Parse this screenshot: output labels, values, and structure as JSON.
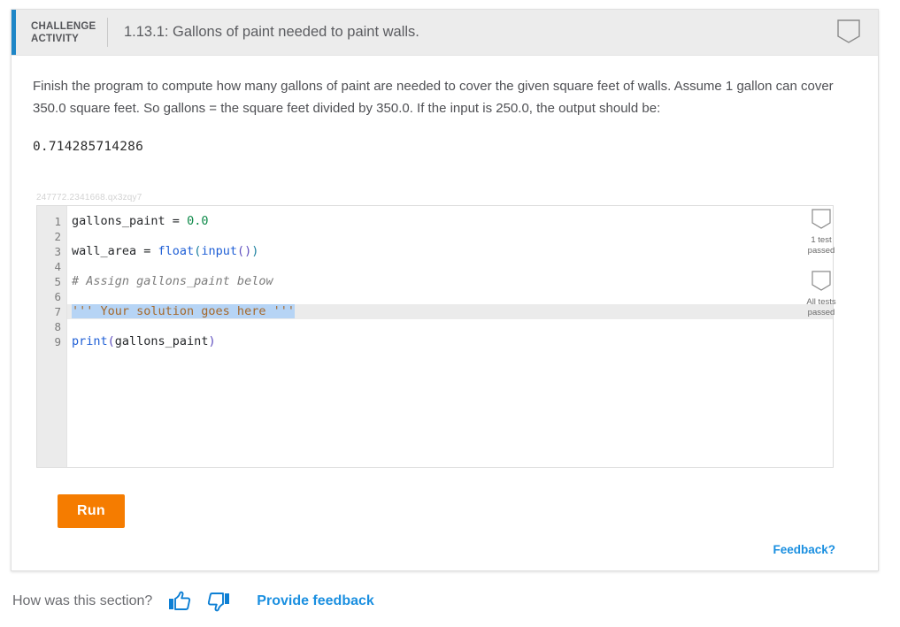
{
  "header": {
    "kicker_line1": "CHALLENGE",
    "kicker_line2": "ACTIVITY",
    "title": "1.13.1: Gallons of paint needed to paint walls.",
    "badge_icon": "shield-badge-icon",
    "accent_color": "#1e86c7"
  },
  "body": {
    "prompt": "Finish the program to compute how many gallons of paint are needed to cover the given square feet of walls. Assume 1 gallon can cover 350.0 square feet. So gallons = the square feet divided by 350.0. If the input is 250.0, the output should be:",
    "expected_output": "0.714285714286"
  },
  "editor": {
    "watermark": "247772.2341668.qx3zqy7",
    "line_numbers": [
      "1",
      "2",
      "3",
      "4",
      "5",
      "6",
      "7",
      "8",
      "9"
    ],
    "lines": [
      "gallons_paint = 0.0",
      "",
      "wall_area = float(input())",
      "",
      "# Assign gallons_paint below",
      "",
      "''' Your solution goes here '''",
      "",
      "print(gallons_paint)"
    ],
    "active_line": 7,
    "selected_text": "''' Your solution goes here '''",
    "l1_name": "gallons_paint ",
    "l1_eq": "= ",
    "l1_num": "0.0",
    "l3_name": "wall_area ",
    "l3_eq": "= ",
    "l3_float": "float",
    "l3_open": "(",
    "l3_input": "input",
    "l3_inner": "()",
    "l3_close": ")",
    "l5_comment": "# Assign gallons_paint below",
    "l7_text": "''' Your solution goes here '''",
    "l9_print": "print",
    "l9_open": "(",
    "l9_arg": "gallons_paint",
    "l9_close": ")"
  },
  "tests": [
    {
      "icon": "shield-outline-icon",
      "label_line1": "1 test",
      "label_line2": "passed"
    },
    {
      "icon": "shield-outline-icon",
      "label_line1": "All tests",
      "label_line2": "passed"
    }
  ],
  "actions": {
    "run_label": "Run",
    "run_color": "#f57c00",
    "feedback_label": "Feedback?",
    "link_color": "#1a8fe0"
  },
  "section_feedback": {
    "question": "How was this section?",
    "thumbs_up_icon": "thumbs-up-icon",
    "thumbs_down_icon": "thumbs-down-icon",
    "provide_feedback_label": "Provide feedback"
  }
}
